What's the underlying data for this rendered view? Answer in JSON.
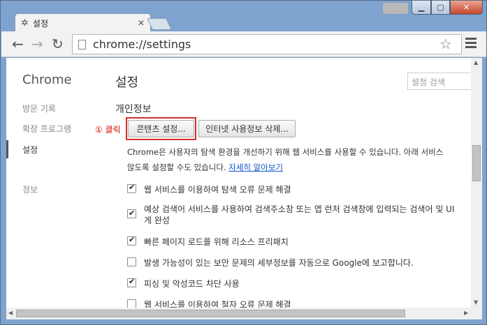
{
  "window": {
    "title_tab": "설정",
    "controls": {
      "minimize": "▁",
      "maximize": "▢",
      "close": "✕"
    }
  },
  "toolbar": {
    "url": "chrome://settings",
    "back": "←",
    "forward": "→",
    "reload": "↻",
    "star": "☆"
  },
  "sidebar": {
    "brand": "Chrome",
    "items": [
      {
        "label": "방문 기록"
      },
      {
        "label": "확장 프로그램"
      },
      {
        "label": "설정"
      },
      {
        "label": "정보"
      }
    ]
  },
  "main": {
    "title": "설정",
    "search_placeholder": "설정 검색",
    "section_title": "개인정보",
    "annotation": "① 클릭",
    "content_settings_button": "콘텐츠 설정...",
    "clear_browsing_button": "인터넷 사용정보 삭제...",
    "description_line1": "Chrome은 사용자의 탐색 환경을 개선하기 위해 웹 서비스를 사용할 수 있습니다. 아래 서비스",
    "description_line2": "않도록 설정할 수도 있습니다.",
    "learn_more": "자세히 알아보기",
    "options": [
      {
        "label": "웹 서비스를 이용하여 탐색 오류 문제 해결",
        "checked": true
      },
      {
        "label": "예상 검색어 서비스를 사용하여 검색주소창 또는 앱 런처 검색창에 입력되는 검색어 및 UI",
        "label2": "게 완성",
        "checked": true
      },
      {
        "label": "빠른 페이지 로드를 위해 리소스 프리패치",
        "checked": true
      },
      {
        "label": "발생 가능성이 있는 보안 문제의 세부정보를 자동으로 Google에 보고합니다.",
        "checked": false
      },
      {
        "label": "피싱 및 악성코드 차단 사용",
        "checked": true
      },
      {
        "label": "웹 서비스를 이용하여 철자 오류 문제 해결",
        "checked": false
      }
    ]
  }
}
